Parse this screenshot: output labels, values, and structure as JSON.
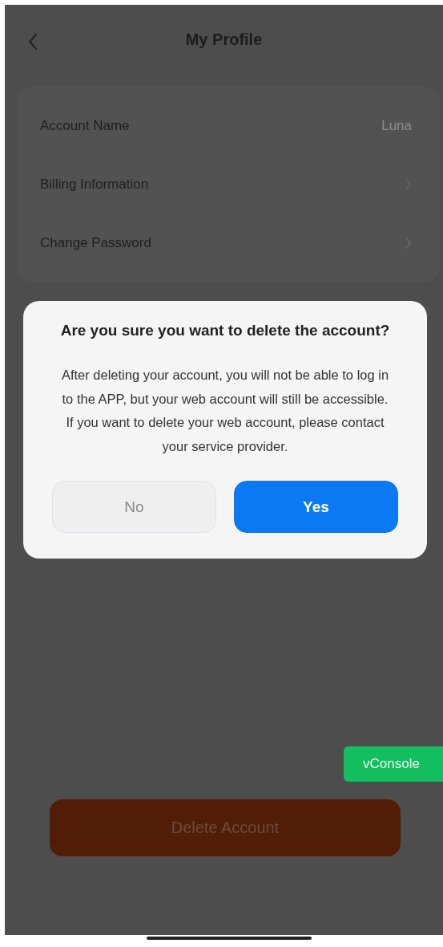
{
  "header": {
    "title": "My Profile"
  },
  "settings": [
    {
      "kind": "value",
      "label": "Account Name",
      "value": "Luna"
    },
    {
      "kind": "link",
      "label": "Billing Information"
    },
    {
      "kind": "link",
      "label": "Change Password"
    }
  ],
  "delete_button": {
    "label": "Delete Account"
  },
  "dialog": {
    "title": "Are you sure you want to delete the account?",
    "message": "After deleting your account, you will not be able to log in to the APP, but your web account will still be accessible. If you want to delete your web account, please contact your service provider.",
    "buttons": [
      {
        "label": "No",
        "primary": false
      },
      {
        "label": "Yes",
        "primary": true
      }
    ]
  },
  "vconsole_button": {
    "label": "vConsole"
  }
}
